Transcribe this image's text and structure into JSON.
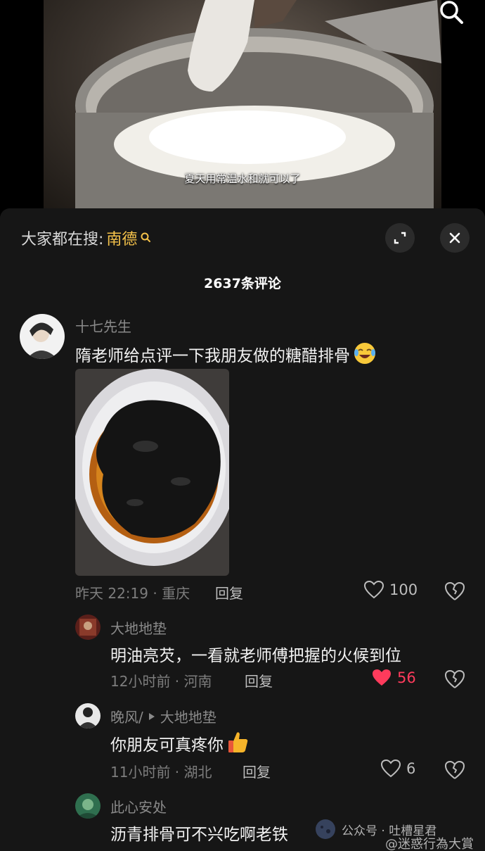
{
  "video": {
    "subtitle": "夏天用常温水和就可以了",
    "search_icon": "search-icon"
  },
  "panel": {
    "hot_search_prefix": "大家都在搜:",
    "hot_search_keyword": "南德",
    "comment_count": "2637条评论",
    "expand_icon": "expand-icon",
    "close_icon": "close-icon"
  },
  "comments": [
    {
      "user": "十七先生",
      "text": "隋老师给点评一下我朋友做的糖醋排骨",
      "emoji": "crying-laughing-emoji",
      "time_location": "昨天 22:19 · 重庆",
      "reply_label": "回复",
      "likes": "100",
      "liked": false,
      "has_image": true
    },
    {
      "user": "大地地垫",
      "text": "明油亮芡，一看就老师傅把握的火候到位",
      "time_location": "12小时前 · 河南",
      "reply_label": "回复",
      "likes": "56",
      "liked": true
    },
    {
      "user": "晚风/",
      "reply_to": "大地地垫",
      "text": "你朋友可真疼你",
      "emoji": "thumbs-up-emoji",
      "time_location": "11小时前 · 湖北",
      "reply_label": "回复",
      "likes": "6",
      "liked": false
    },
    {
      "user": "此心安处",
      "text": "沥青排骨可不兴吃啊老铁"
    }
  ],
  "watermark": {
    "gzh": "公众号 · 吐槽星君",
    "weibo": "@迷惑行為大賞"
  },
  "colors": {
    "panel_bg": "#161616",
    "keyword": "#f5c24a",
    "liked": "#ff3b5c",
    "muted": "#8a8a8a"
  }
}
